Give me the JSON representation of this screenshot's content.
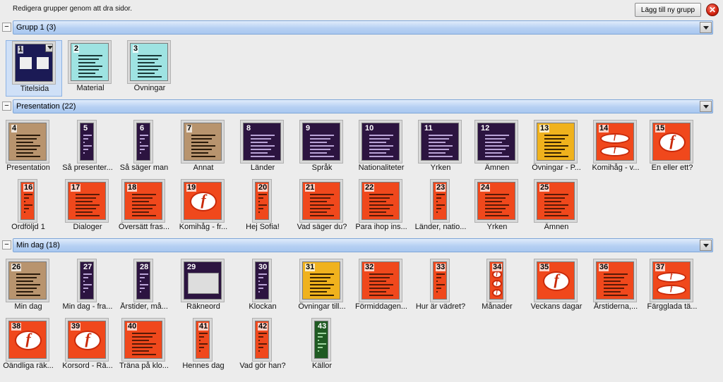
{
  "toolbar": {
    "instruction": "Redigera grupper genom att dra sidor.",
    "add_group_label": "Lägg till ny grupp",
    "close_icon": "close-icon"
  },
  "groups": [
    {
      "title": "Grupp 1 (3)",
      "slides": [
        {
          "num": "1",
          "label": "Titelsida",
          "theme": "navy",
          "selected": true
        },
        {
          "num": "2",
          "label": "Material",
          "theme": "teal"
        },
        {
          "num": "3",
          "label": "Övningar",
          "theme": "teal"
        }
      ]
    },
    {
      "title": "Presentation (22)",
      "slides": [
        {
          "num": "4",
          "label": "Presentation",
          "theme": "tan"
        },
        {
          "num": "5",
          "label": "Så presenter...",
          "theme": "purple",
          "narrow": true
        },
        {
          "num": "6",
          "label": "Så säger man",
          "theme": "purple",
          "narrow": true
        },
        {
          "num": "7",
          "label": "Annat",
          "theme": "tan"
        },
        {
          "num": "8",
          "label": "Länder",
          "theme": "purple"
        },
        {
          "num": "9",
          "label": "Språk",
          "theme": "purple"
        },
        {
          "num": "10",
          "label": "Nationaliteter",
          "theme": "purple"
        },
        {
          "num": "11",
          "label": "Yrken",
          "theme": "purple"
        },
        {
          "num": "12",
          "label": "Ämnen",
          "theme": "purple"
        },
        {
          "num": "13",
          "label": "Övningar - P...",
          "theme": "yellow"
        },
        {
          "num": "14",
          "label": "Komihåg - v...",
          "theme": "orange-logo"
        },
        {
          "num": "15",
          "label": "En eller ett?",
          "theme": "orange-logo-big"
        },
        {
          "num": "16",
          "label": "Ordföljd 1",
          "theme": "orange",
          "narrow": true
        },
        {
          "num": "17",
          "label": "Dialoger",
          "theme": "orange"
        },
        {
          "num": "18",
          "label": "Översätt fras...",
          "theme": "orange"
        },
        {
          "num": "19",
          "label": "Komihåg - fr...",
          "theme": "orange-logo-big"
        },
        {
          "num": "20",
          "label": "Hej Sofia!",
          "theme": "orange",
          "narrow": true
        },
        {
          "num": "21",
          "label": "Vad säger du?",
          "theme": "orange"
        },
        {
          "num": "22",
          "label": "Para ihop ins...",
          "theme": "orange"
        },
        {
          "num": "23",
          "label": "Länder, natio...",
          "theme": "orange",
          "narrow": true
        },
        {
          "num": "24",
          "label": "Yrken",
          "theme": "orange"
        },
        {
          "num": "25",
          "label": "Ämnen",
          "theme": "orange"
        }
      ]
    },
    {
      "title": "Min dag (18)",
      "slides": [
        {
          "num": "26",
          "label": "Min dag",
          "theme": "tan"
        },
        {
          "num": "27",
          "label": "Min dag - fra...",
          "theme": "purple",
          "narrow": true
        },
        {
          "num": "28",
          "label": "Årstider, må...",
          "theme": "purple",
          "narrow": true
        },
        {
          "num": "29",
          "label": "Räkneord",
          "theme": "purple-screen"
        },
        {
          "num": "30",
          "label": "Klockan",
          "theme": "purple",
          "narrow": true
        },
        {
          "num": "31",
          "label": "Övningar till...",
          "theme": "yellow"
        },
        {
          "num": "32",
          "label": "Förmiddagen...",
          "theme": "orange"
        },
        {
          "num": "33",
          "label": "Hur är vädret?",
          "theme": "orange",
          "narrow": true
        },
        {
          "num": "34",
          "label": "Månader",
          "theme": "orange-logo",
          "narrow": true
        },
        {
          "num": "35",
          "label": "Veckans dagar",
          "theme": "orange-logo-big"
        },
        {
          "num": "36",
          "label": "Årstiderna,...",
          "theme": "orange"
        },
        {
          "num": "37",
          "label": "Färgglada tä...",
          "theme": "orange-logo"
        },
        {
          "num": "38",
          "label": "Oändliga räk...",
          "theme": "orange-logo-big"
        },
        {
          "num": "39",
          "label": "Korsord - Rä...",
          "theme": "orange-logo-big"
        },
        {
          "num": "40",
          "label": "Träna på klo...",
          "theme": "orange"
        },
        {
          "num": "41",
          "label": "Hennes dag",
          "theme": "orange",
          "narrow": true
        },
        {
          "num": "42",
          "label": "Vad gör han?",
          "theme": "orange",
          "narrow": true
        },
        {
          "num": "43",
          "label": "Källor",
          "theme": "green",
          "narrow": true
        }
      ]
    }
  ],
  "colors": {
    "navy": "#1b1a55",
    "teal": "#9ee3e2",
    "tan": "#b8946e",
    "purple": "#2c1440",
    "yellow": "#f0b21d",
    "orange": "#f0481c",
    "green": "#1f5a22",
    "group_bar": "#b6d0f3"
  }
}
